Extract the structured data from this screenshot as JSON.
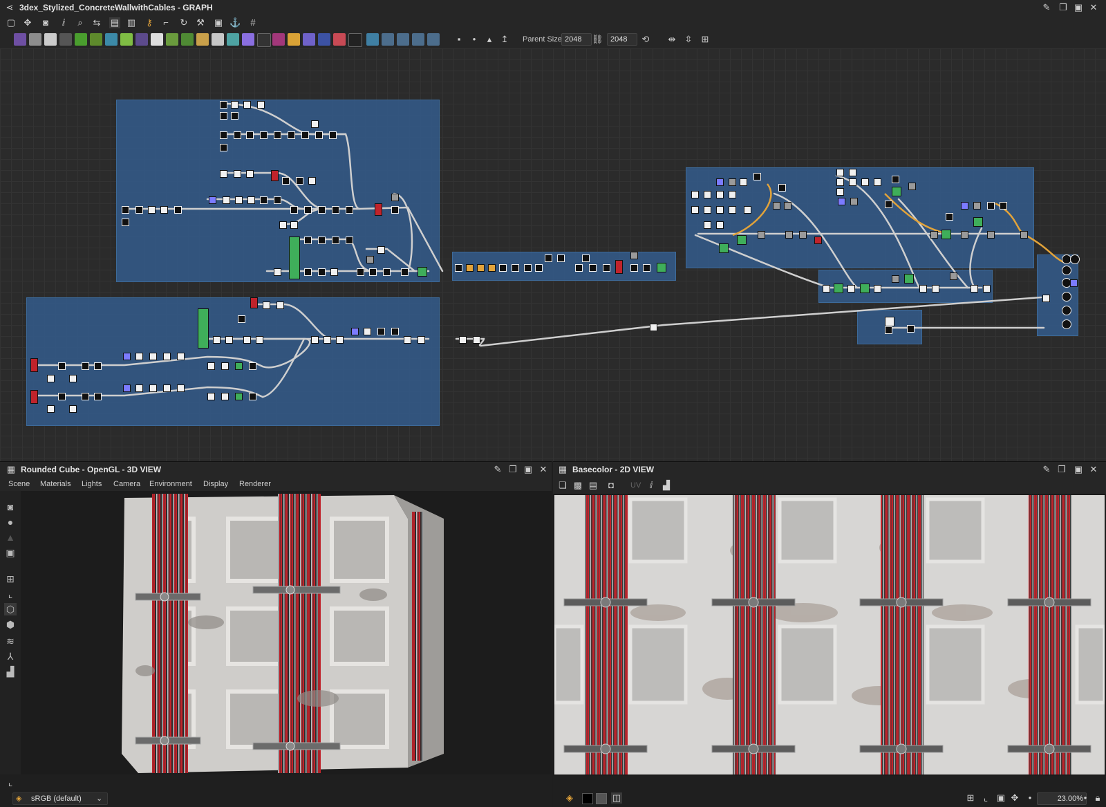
{
  "graph": {
    "title": "3dex_Stylized_ConcreteWallwithCables - GRAPH",
    "parent_size_label": "Parent Size:",
    "parent_size_value": "2048",
    "output_size_value": "2048"
  },
  "view3d": {
    "title": "Rounded Cube - OpenGL - 3D VIEW",
    "menu": [
      "Scene",
      "Materials",
      "Lights",
      "Camera",
      "Environment",
      "Display",
      "Renderer"
    ],
    "colorspace": "sRGB (default)"
  },
  "view2d": {
    "title": "Basecolor - 2D VIEW",
    "uv_label": "UV",
    "zoom": "23.00%"
  },
  "colors": {
    "frame": "#34608c",
    "cable_red": "#c0232b",
    "concrete": "#d4d2cf",
    "accent_orange": "#e2a33a"
  }
}
